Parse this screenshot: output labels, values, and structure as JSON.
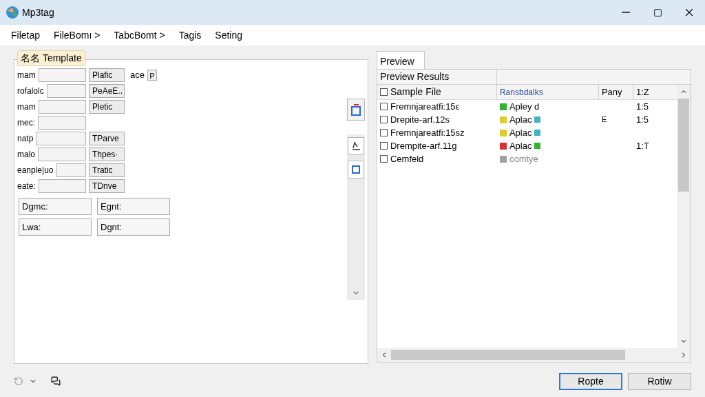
{
  "window": {
    "title": "Mp3tag"
  },
  "menu": [
    "Filetap",
    "FileBomı >",
    "TabcBomt >",
    "Tagis",
    "Seting"
  ],
  "template": {
    "title": "名名 Template",
    "rows": [
      {
        "label": "mam",
        "button": "Plafic",
        "extra": "ace",
        "extra_button": "P"
      },
      {
        "label": "rofalolc",
        "button": "PeAeE.."
      },
      {
        "label": "mam",
        "button": "Pletic"
      },
      {
        "label": "mec:"
      },
      {
        "label": "natp",
        "button": "TParve"
      },
      {
        "label": "malo",
        "button": "Thpes·"
      },
      {
        "label": "eanple|uo",
        "button": "Tratic"
      },
      {
        "label": "eate:",
        "button": "TDnve"
      }
    ],
    "fields": [
      "Dgmc:",
      "Egnt:",
      "Lwa:",
      "Dgnt:"
    ]
  },
  "preview": {
    "tab": "Preview",
    "header": "Preview Results",
    "columns": [
      "Sample File",
      "Ransbdalks",
      "Pany",
      "1:Z"
    ],
    "all_checked": false,
    "rows": [
      {
        "name": "Fremnjareatfi:15ε",
        "checked": false,
        "color": "#2fb52f",
        "value": "Apley d",
        "column_3": null,
        "column_4": "1:5"
      },
      {
        "name": "Drepite-arf.12s",
        "checked": false,
        "color": "#e0cc2a",
        "value": "Aplac",
        "badge": {
          "color": "#3fb3c0"
        },
        "column_3": "E",
        "column_4": "1:5"
      },
      {
        "name": "Fremnjareatfi:15sz",
        "checked": false,
        "color": "#e0cc2a",
        "value": "Aplac",
        "badge": {
          "color": "#3fb3c0"
        },
        "column_3": null,
        "column_4": null
      },
      {
        "name": "Drempite-arf.11g",
        "checked": false,
        "color": "#d83030",
        "value": "Aplac",
        "badge": {
          "color": "#2fb52f"
        },
        "column_3": null,
        "column_4": "1:T"
      },
      {
        "name": "Cemfeld",
        "checked": false,
        "color": "#a0a0a0",
        "value": "comtye",
        "column_3": null,
        "column_4": null
      }
    ]
  },
  "buttons": [
    {
      "label": "Ropte",
      "default": true
    },
    {
      "label": "Rotiw",
      "default": false
    }
  ]
}
